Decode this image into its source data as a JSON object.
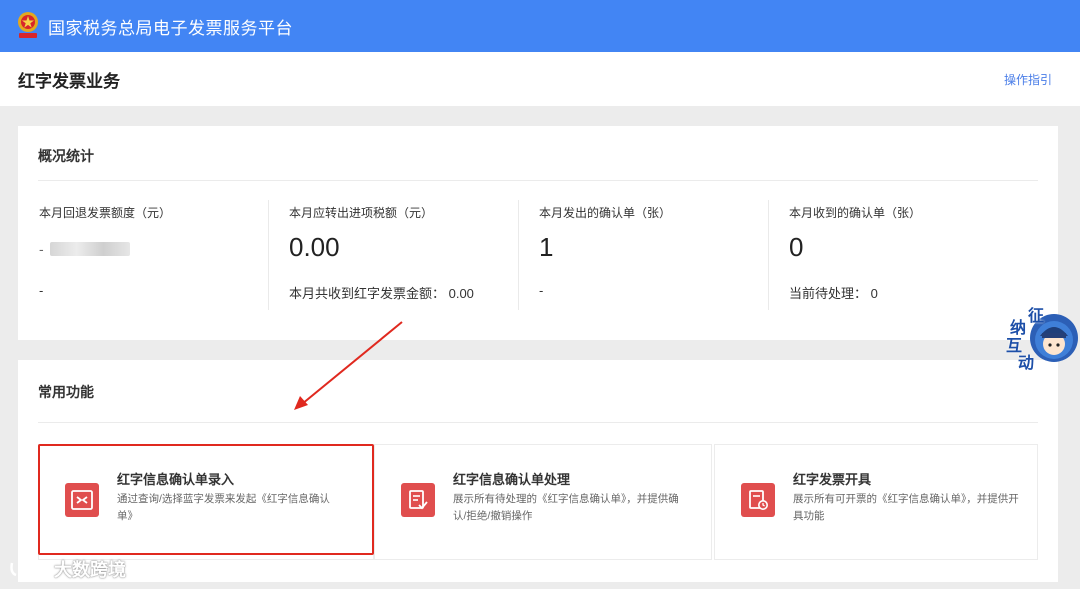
{
  "app": {
    "title": "国家税务总局电子发票服务平台"
  },
  "header": {
    "title": "红字发票业务",
    "guide_link": "操作指引"
  },
  "stats": {
    "title": "概况统计",
    "items": [
      {
        "label": "本月回退发票额度（元）",
        "value": "",
        "sub": "-"
      },
      {
        "label": "本月应转出进项税额（元）",
        "value": "0.00",
        "sub": "本月共收到红字发票金额：  0.00"
      },
      {
        "label": "本月发出的确认单（张）",
        "value": "1",
        "sub": "-"
      },
      {
        "label": "本月收到的确认单（张）",
        "value": "0",
        "sub": "当前待处理：  0"
      }
    ]
  },
  "functions": {
    "title": "常用功能",
    "tiles": [
      {
        "title": "红字信息确认单录入",
        "desc": "通过查询/选择蓝字发票来发起《红字信息确认单》",
        "icon": "swap-document-icon"
      },
      {
        "title": "红字信息确认单处理",
        "desc": "展示所有待处理的《红字信息确认单》，并提供确认/拒绝/撤销操作",
        "icon": "document-check-icon"
      },
      {
        "title": "红字发票开具",
        "desc": "展示所有可开票的《红字信息确认单》，并提供开具功能",
        "icon": "document-clock-icon"
      }
    ]
  },
  "assistant": {
    "chars": [
      "征",
      "纳",
      "互",
      "动"
    ]
  },
  "watermark": {
    "text": "大数跨境"
  },
  "colors": {
    "topbar": "#4285f4",
    "accent_red": "#e04e4e",
    "highlight": "#e0291f",
    "link": "#4a7ee8"
  }
}
